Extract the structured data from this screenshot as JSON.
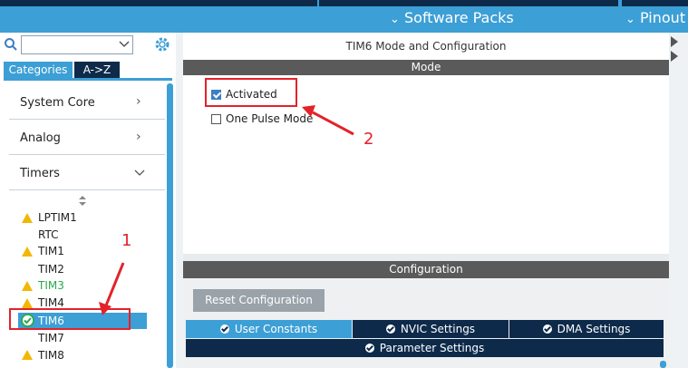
{
  "topbar": {
    "software_packs": "Software Packs",
    "pinout": "Pinout"
  },
  "sidebar": {
    "search": {
      "value": "",
      "placeholder": ""
    },
    "tabs": {
      "categories": "Categories",
      "az": "A->Z"
    },
    "categories": [
      {
        "label": "System Core"
      },
      {
        "label": "Analog"
      },
      {
        "label": "Timers"
      }
    ],
    "timers": [
      {
        "label": "LPTIM1",
        "status": "warning"
      },
      {
        "label": "RTC",
        "status": "none"
      },
      {
        "label": "TIM1",
        "status": "warning"
      },
      {
        "label": "TIM2",
        "status": "none"
      },
      {
        "label": "TIM3",
        "status": "warning-green"
      },
      {
        "label": "TIM4",
        "status": "warning"
      },
      {
        "label": "TIM6",
        "status": "ok-selected"
      },
      {
        "label": "TIM7",
        "status": "none"
      },
      {
        "label": "TIM8",
        "status": "warning"
      }
    ]
  },
  "main": {
    "title": "TIM6 Mode and Configuration",
    "mode_header": "Mode",
    "activated_label": "Activated",
    "activated_checked": true,
    "one_pulse_label": "One Pulse Mode",
    "one_pulse_checked": false,
    "config_header": "Configuration",
    "reset_button": "Reset Configuration",
    "tabs": [
      "User Constants",
      "NVIC Settings",
      "DMA Settings"
    ],
    "param_tab": "Parameter Settings"
  },
  "annotations": {
    "label1": "1",
    "label2": "2"
  },
  "colors": {
    "accent": "#3c9fd6",
    "dark": "#0d2a4a",
    "annotation": "#e3222a"
  }
}
